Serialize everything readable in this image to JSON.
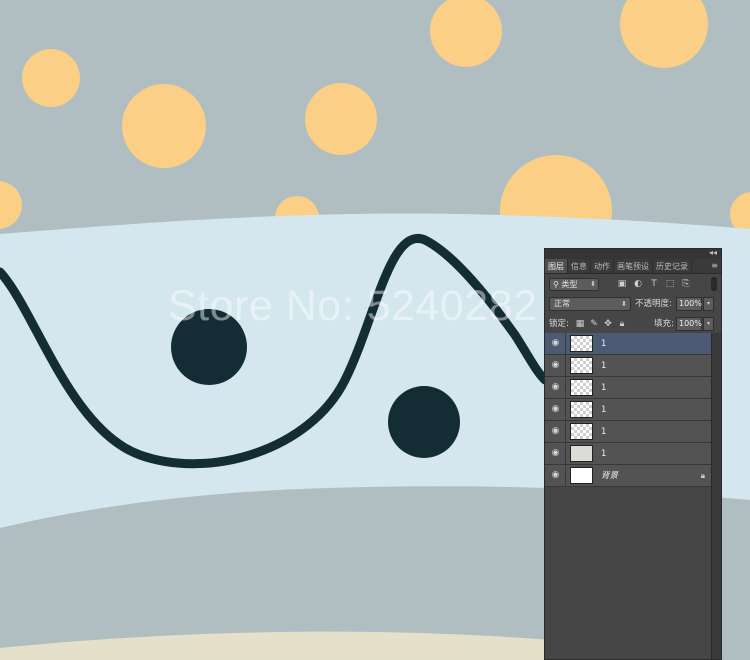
{
  "canvas": {
    "colors": {
      "sky": "#b0bec2",
      "band_light": "#d4e6ee",
      "band_grey": "#b1bec0",
      "sand": "#e5e0c9",
      "dot_yellow": "#fbcf85",
      "ink": "#142d35"
    },
    "watermark": "Store No: 5240282"
  },
  "layers_panel": {
    "tabs": [
      {
        "label": "图层",
        "active": true
      },
      {
        "label": "信息",
        "active": false
      },
      {
        "label": "动作",
        "active": false
      },
      {
        "label": "画笔预设",
        "active": false
      },
      {
        "label": "历史记录",
        "active": false
      }
    ],
    "filter": {
      "kind_label": "类型",
      "icons": [
        "image-filter-icon",
        "adjustment-filter-icon",
        "type-filter-icon",
        "shape-filter-icon",
        "smart-object-filter-icon"
      ]
    },
    "blend_mode": "正常",
    "opacity_label": "不透明度:",
    "opacity_value": "100%",
    "lock_label": "锁定:",
    "fill_label": "填充:",
    "fill_value": "100%",
    "layers": [
      {
        "name": "1",
        "thumbnail": "transparent",
        "selected": true
      },
      {
        "name": "1",
        "thumbnail": "transparent",
        "selected": false
      },
      {
        "name": "1",
        "thumbnail": "transparent",
        "selected": false
      },
      {
        "name": "1",
        "thumbnail": "transparent",
        "selected": false
      },
      {
        "name": "1",
        "thumbnail": "transparent",
        "selected": false
      },
      {
        "name": "1",
        "thumbnail": "solid",
        "selected": false
      },
      {
        "name": "背景",
        "thumbnail": "white",
        "selected": false,
        "locked": true
      }
    ]
  }
}
